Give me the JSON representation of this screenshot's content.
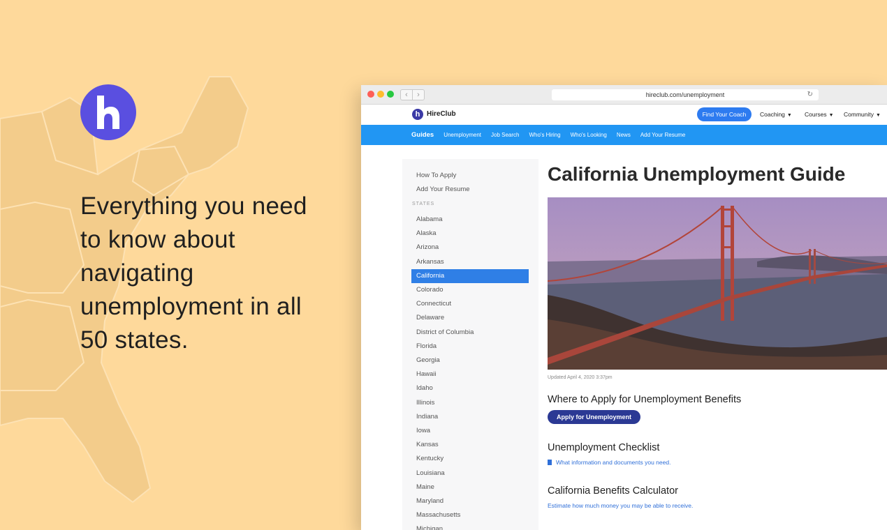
{
  "tagline": "Everything you need to know about navigating unemployment in all 50 states.",
  "browser": {
    "url": "hireclub.com/unemployment"
  },
  "site": {
    "name": "HireClub",
    "find_coach": "Find Your Coach",
    "nav": [
      "Coaching",
      "Courses",
      "Community"
    ]
  },
  "guides_nav": {
    "title": "Guides",
    "items": [
      "Unemployment",
      "Job Search",
      "Who's Hiring",
      "Who's Looking",
      "News",
      "Add Your Resume"
    ]
  },
  "sidebar": {
    "links": [
      "How To Apply",
      "Add Your Resume"
    ],
    "states_label": "STATES",
    "states": [
      "Alabama",
      "Alaska",
      "Arizona",
      "Arkansas",
      "California",
      "Colorado",
      "Connecticut",
      "Delaware",
      "District of Columbia",
      "Florida",
      "Georgia",
      "Hawaii",
      "Idaho",
      "Illinois",
      "Indiana",
      "Iowa",
      "Kansas",
      "Kentucky",
      "Louisiana",
      "Maine",
      "Maryland",
      "Massachusetts",
      "Michigan"
    ],
    "active_state": "California"
  },
  "main": {
    "title": "California Unemployment Guide",
    "updated": "Updated April 4, 2020 3:37pm",
    "apply_heading": "Where to Apply for Unemployment Benefits",
    "apply_button": "Apply for Unemployment",
    "checklist_heading": "Unemployment Checklist",
    "checklist_link": "What information and documents you need.",
    "calculator_heading": "California Benefits Calculator",
    "calculator_link": "Estimate how much money you may be able to receive."
  },
  "colors": {
    "background": "#fed99b",
    "brand_purple": "#5a4fe0",
    "nav_blue": "#2196f3",
    "active_blue": "#2f7fe6",
    "apply_button": "#2b3994"
  }
}
